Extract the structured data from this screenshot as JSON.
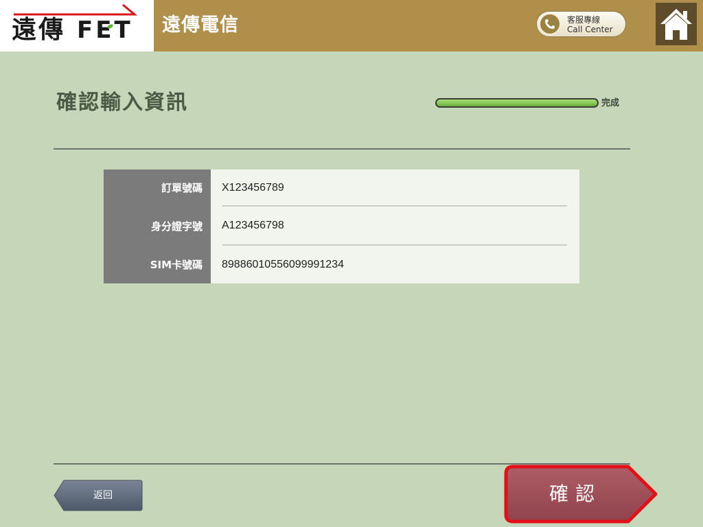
{
  "header": {
    "logo_text": "遠傳",
    "logo_brand": "FET",
    "company_name": "遠傳電信",
    "call_center": {
      "line1": "客服專線",
      "line2": "Call Center",
      "icon": "phone-icon"
    },
    "home_icon": "home-icon"
  },
  "page": {
    "title": "確認輸入資訊",
    "progress": {
      "label": "完成",
      "value": 1
    }
  },
  "info": {
    "rows": [
      {
        "label": "訂單號碼",
        "value": "X123456789"
      },
      {
        "label": "身分證字號",
        "value": "A123456798"
      },
      {
        "label": "SIM卡號碼",
        "value": "89886010556099991234"
      }
    ]
  },
  "footer": {
    "back_label": "返回",
    "back_icon": "arrow-left-icon",
    "confirm_label": "確認",
    "confirm_icon": "arrow-right-icon"
  },
  "colors": {
    "header_bg": "#b08f4a",
    "page_bg": "#c6d6b9",
    "home_bg": "#5e4c2b",
    "title_color": "#4b5a45",
    "label_bg": "#7b7b7b",
    "value_bg": "#f1f5ee",
    "progress_fill": "#84c553",
    "back_button": "#5c6878",
    "confirm_fill": "#a0505a",
    "confirm_border": "#e3101a",
    "logo_red": "#d7141b"
  }
}
